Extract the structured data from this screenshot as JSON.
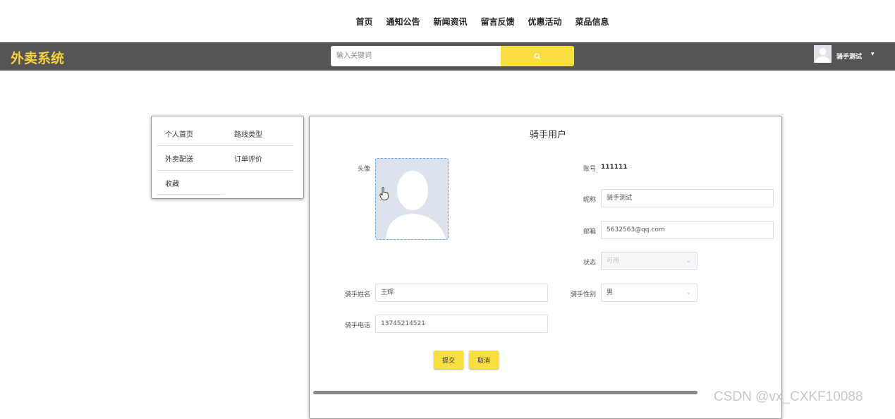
{
  "nav": {
    "items": [
      "首页",
      "通知公告",
      "新闻资讯",
      "留言反馈",
      "优惠活动",
      "菜品信息"
    ]
  },
  "header": {
    "logo": "外卖系统",
    "search_placeholder": "输入关键词",
    "username": "骑手测试",
    "accent_color": "#f9de3f",
    "bar_color": "#555555"
  },
  "side_menu": {
    "items": [
      "个人首页",
      "路线类型",
      "外卖配送",
      "订单评价",
      "收藏"
    ]
  },
  "profile": {
    "title": "骑手用户",
    "avatar_label": "头像",
    "account_label": "账号",
    "account_value": "111111",
    "nickname_label": "昵称",
    "nickname_value": "骑手测试",
    "email_label": "邮箱",
    "email_value": "5632563@qq.com",
    "status_label": "状态",
    "status_value": "可用",
    "rider_name_label": "骑手姓名",
    "rider_name_value": "王辉",
    "rider_gender_label": "骑手性别",
    "rider_gender_value": "男",
    "rider_phone_label": "骑手电话",
    "rider_phone_value": "13745214521",
    "submit_label": "提交",
    "cancel_label": "取消"
  },
  "watermark": "CSDN @vx_CXKF10088"
}
